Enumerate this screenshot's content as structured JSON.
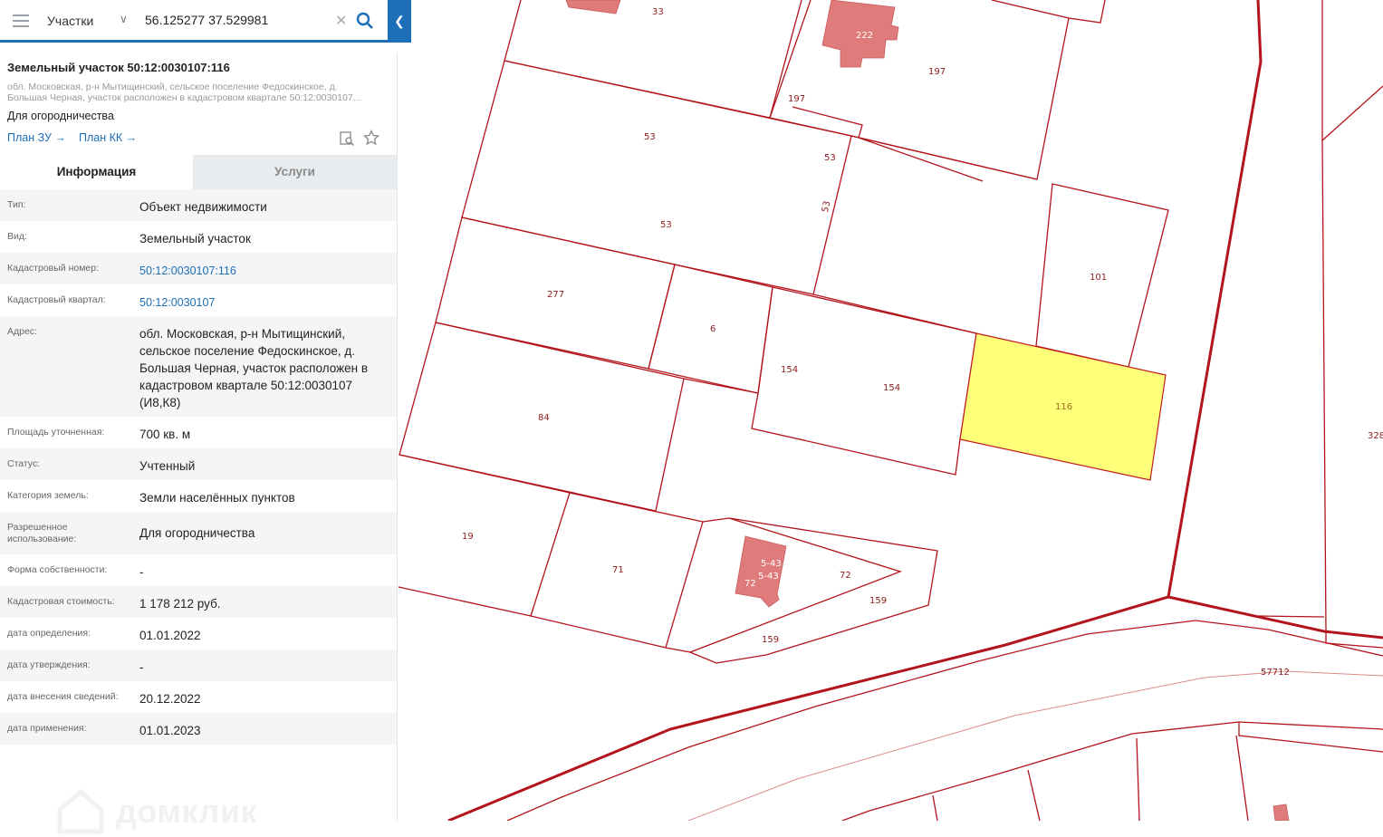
{
  "search": {
    "layer": "Участки",
    "query": "56.125277 37.529981"
  },
  "parcel": {
    "title": "Земельный участок 50:12:0030107:116",
    "address_short": "обл. Московская, р-н Мытищинский, сельское поселение Федоскинское, д. Большая Черная, участок расположен в кадастровом квартале 50:12:0030107...",
    "use": "Для огородничества",
    "link_zu": "План ЗУ →",
    "link_kk": "План КК →"
  },
  "tabs": {
    "info": "Информация",
    "services": "Услуги"
  },
  "details": [
    {
      "label": "Тип:",
      "value": "Объект недвижимости"
    },
    {
      "label": "Вид:",
      "value": "Земельный участок"
    },
    {
      "label": "Кадастровый номер:",
      "value": "50:12:0030107:116",
      "link": true
    },
    {
      "label": "Кадастровый квартал:",
      "value": "50:12:0030107",
      "link": true
    },
    {
      "label": "Адрес:",
      "value": "обл. Московская, р-н Мытищинский, сельское поселение Федоскинское, д. Большая Черная, участок расположен в кадастровом квартале 50:12:0030107 (И8,К8)"
    },
    {
      "label": "Площадь уточненная:",
      "value": "700 кв. м"
    },
    {
      "label": "Статус:",
      "value": "Учтенный"
    },
    {
      "label": "Категория земель:",
      "value": "Земли населённых пунктов"
    },
    {
      "label": "Разрешенное использование:",
      "value": "Для огородничества"
    },
    {
      "label": "Форма собственности:",
      "value": "-"
    },
    {
      "label": "Кадастровая стоимость:",
      "value": "1 178 212 руб."
    },
    {
      "label": "дата определения:",
      "value": "01.01.2022"
    },
    {
      "label": "дата утверждения:",
      "value": "-"
    },
    {
      "label": "дата внесения сведений:",
      "value": "20.12.2022"
    },
    {
      "label": "дата применения:",
      "value": "01.01.2023"
    }
  ],
  "watermark": "домклик",
  "map_labels": [
    "33",
    "222",
    "197",
    "197",
    "53",
    "53",
    "53",
    "53",
    "101",
    "277",
    "6",
    "154",
    "154",
    "116",
    "84",
    "328",
    "19",
    "71",
    "5-43",
    "5-43",
    "72",
    "72",
    "159",
    "159",
    "57712"
  ],
  "colors": {
    "boundary": "#b3131b",
    "selected_fill": "#ffff7a",
    "building": "#e07b7b",
    "accent": "#1d6fb8"
  }
}
